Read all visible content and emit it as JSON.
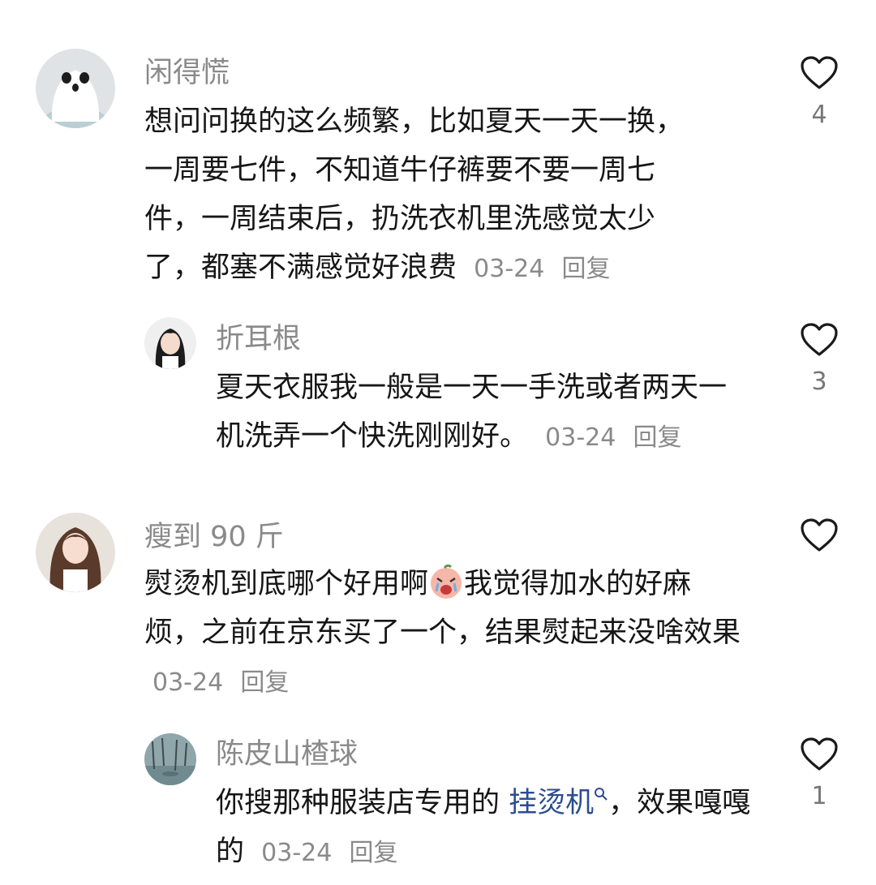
{
  "comments": [
    {
      "username": "闲得慌",
      "text": "想问问换的这么频繁，比如夏天一天一换，一周要七件，不知道牛仔裤要不要一周七件，一周结束后，扔洗衣机里洗感觉太少了，都塞不满感觉好浪费",
      "date": "03-24",
      "reply_label": "回复",
      "likes": "4",
      "avatar_icon": "ghost-avatar"
    },
    {
      "username": "折耳根",
      "text": "夏天衣服我一般是一天一手洗或者两天一机洗弄一个快洗刚刚好。",
      "date": "03-24",
      "reply_label": "回复",
      "likes": "3",
      "avatar_icon": "girl-avatar"
    },
    {
      "username": "瘦到 90 斤",
      "text_before": "熨烫机到底哪个好用啊",
      "text_after": "我觉得加水的好麻烦，之前在京东买了一个，结果熨起来没啥效果",
      "emoji": "crying-peach-emoji",
      "date": "03-24",
      "reply_label": "回复",
      "likes": "",
      "avatar_icon": "woman-avatar"
    },
    {
      "username": "陈皮山楂球",
      "text_before": "你搜那种服装店专用的 ",
      "link_text": "挂烫机",
      "text_after": "，效果嘎嘎的",
      "date": "03-24",
      "reply_label": "回复",
      "likes": "1",
      "avatar_icon": "pond-avatar"
    }
  ],
  "colors": {
    "username": "#8a8a8a",
    "body": "#161616",
    "link": "#2b4d8f",
    "heart_stroke": "#1a1a1a"
  }
}
